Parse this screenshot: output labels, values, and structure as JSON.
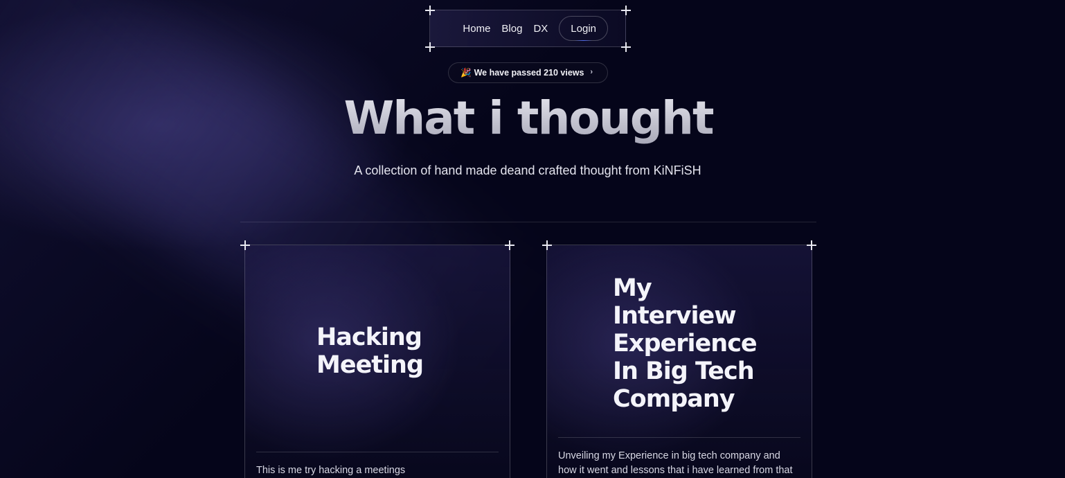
{
  "nav": {
    "links": [
      "Home",
      "Blog",
      "DX"
    ],
    "login_label": "Login"
  },
  "badge": {
    "emoji": "🎉",
    "text": "We have passed 210 views",
    "chevron": "›"
  },
  "hero": {
    "title": "What i thought",
    "subtitle": "A collection of hand made deand crafted thought from KiNFiSH"
  },
  "posts": [
    {
      "title": "Hacking Meeting",
      "description": "This is me try hacking a meetings"
    },
    {
      "title": "My Interview Experience In Big Tech Company",
      "description": "Unveiling my Experience in big tech company and how it went and lessons that i have learned from that"
    }
  ],
  "colors": {
    "background": "#05051a",
    "accent_glow": "#4f6eff"
  }
}
